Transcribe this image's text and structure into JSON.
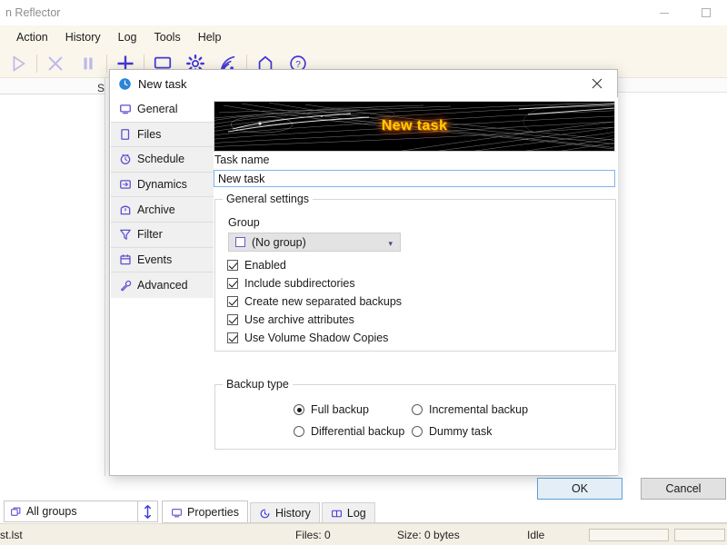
{
  "window": {
    "title": "n Reflector",
    "minimize_icon": "minimize-icon",
    "maximize_icon": "maximize-icon"
  },
  "menubar": {
    "items": [
      {
        "label": "Action"
      },
      {
        "label": "History"
      },
      {
        "label": "Log"
      },
      {
        "label": "Tools"
      },
      {
        "label": "Help"
      }
    ]
  },
  "toolbar": {
    "buttons": [
      {
        "name": "run-button",
        "icon": "play-icon",
        "enabled": false
      },
      {
        "name": "stop-button",
        "icon": "close-x-icon",
        "enabled": false
      },
      {
        "name": "pause-button",
        "icon": "pause-icon",
        "enabled": false
      },
      {
        "name": "new-task-button",
        "icon": "plus-icon",
        "enabled": true
      },
      {
        "name": "monitor-button",
        "icon": "monitor-icon",
        "enabled": true
      },
      {
        "name": "settings-button",
        "icon": "gear-icon",
        "enabled": true
      },
      {
        "name": "network-button",
        "icon": "wifi-icon",
        "enabled": true
      },
      {
        "name": "home-button",
        "icon": "home-icon",
        "enabled": true
      },
      {
        "name": "help-button",
        "icon": "question-circle-icon",
        "enabled": true
      }
    ]
  },
  "workarea": {
    "left_pane_partial_label": "S"
  },
  "bottom": {
    "groups_combo": {
      "label": "All groups",
      "icon": "groups-icon",
      "splitter_icon": "vertical-resize-icon"
    },
    "tabs": [
      {
        "label": "Properties",
        "icon": "monitor-icon",
        "active": true
      },
      {
        "label": "History",
        "icon": "history-icon",
        "active": false
      },
      {
        "label": "Log",
        "icon": "log-book-icon",
        "active": false
      }
    ]
  },
  "statusbar": {
    "path": "st.lst",
    "files": "Files: 0",
    "size": "Size: 0 bytes",
    "state": "Idle"
  },
  "dialog": {
    "title": "New task",
    "title_icon": "task-clock-icon",
    "close_icon": "close-icon",
    "nav": [
      {
        "label": "General",
        "icon": "monitor-icon",
        "active": true
      },
      {
        "label": "Files",
        "icon": "file-icon",
        "active": false
      },
      {
        "label": "Schedule",
        "icon": "clock-icon",
        "active": false
      },
      {
        "label": "Dynamics",
        "icon": "dynamics-icon",
        "active": false
      },
      {
        "label": "Archive",
        "icon": "archive-box-icon",
        "active": false
      },
      {
        "label": "Filter",
        "icon": "funnel-icon",
        "active": false
      },
      {
        "label": "Events",
        "icon": "calendar-icon",
        "active": false
      },
      {
        "label": "Advanced",
        "icon": "wrench-icon",
        "active": false
      }
    ],
    "banner": {
      "text": "New task"
    },
    "task_name": {
      "label": "Task name",
      "value": "New task",
      "placeholder": "New task"
    },
    "general_settings": {
      "legend": "General settings",
      "group": {
        "label": "Group",
        "value": "(No group)",
        "chevron_icon": "chevron-down-icon"
      },
      "checkboxes": [
        {
          "label": "Enabled",
          "checked": true
        },
        {
          "label": "Include subdirectories",
          "checked": true
        },
        {
          "label": "Create new separated backups",
          "checked": true
        },
        {
          "label": "Use archive attributes",
          "checked": true
        },
        {
          "label": "Use Volume Shadow Copies",
          "checked": true
        }
      ]
    },
    "backup_type": {
      "legend": "Backup type",
      "options": [
        {
          "label": "Full backup",
          "selected": true
        },
        {
          "label": "Incremental backup",
          "selected": false
        },
        {
          "label": "Differential backup",
          "selected": false
        },
        {
          "label": "Dummy task",
          "selected": false
        }
      ]
    },
    "buttons": {
      "ok": "OK",
      "cancel": "Cancel"
    }
  }
}
